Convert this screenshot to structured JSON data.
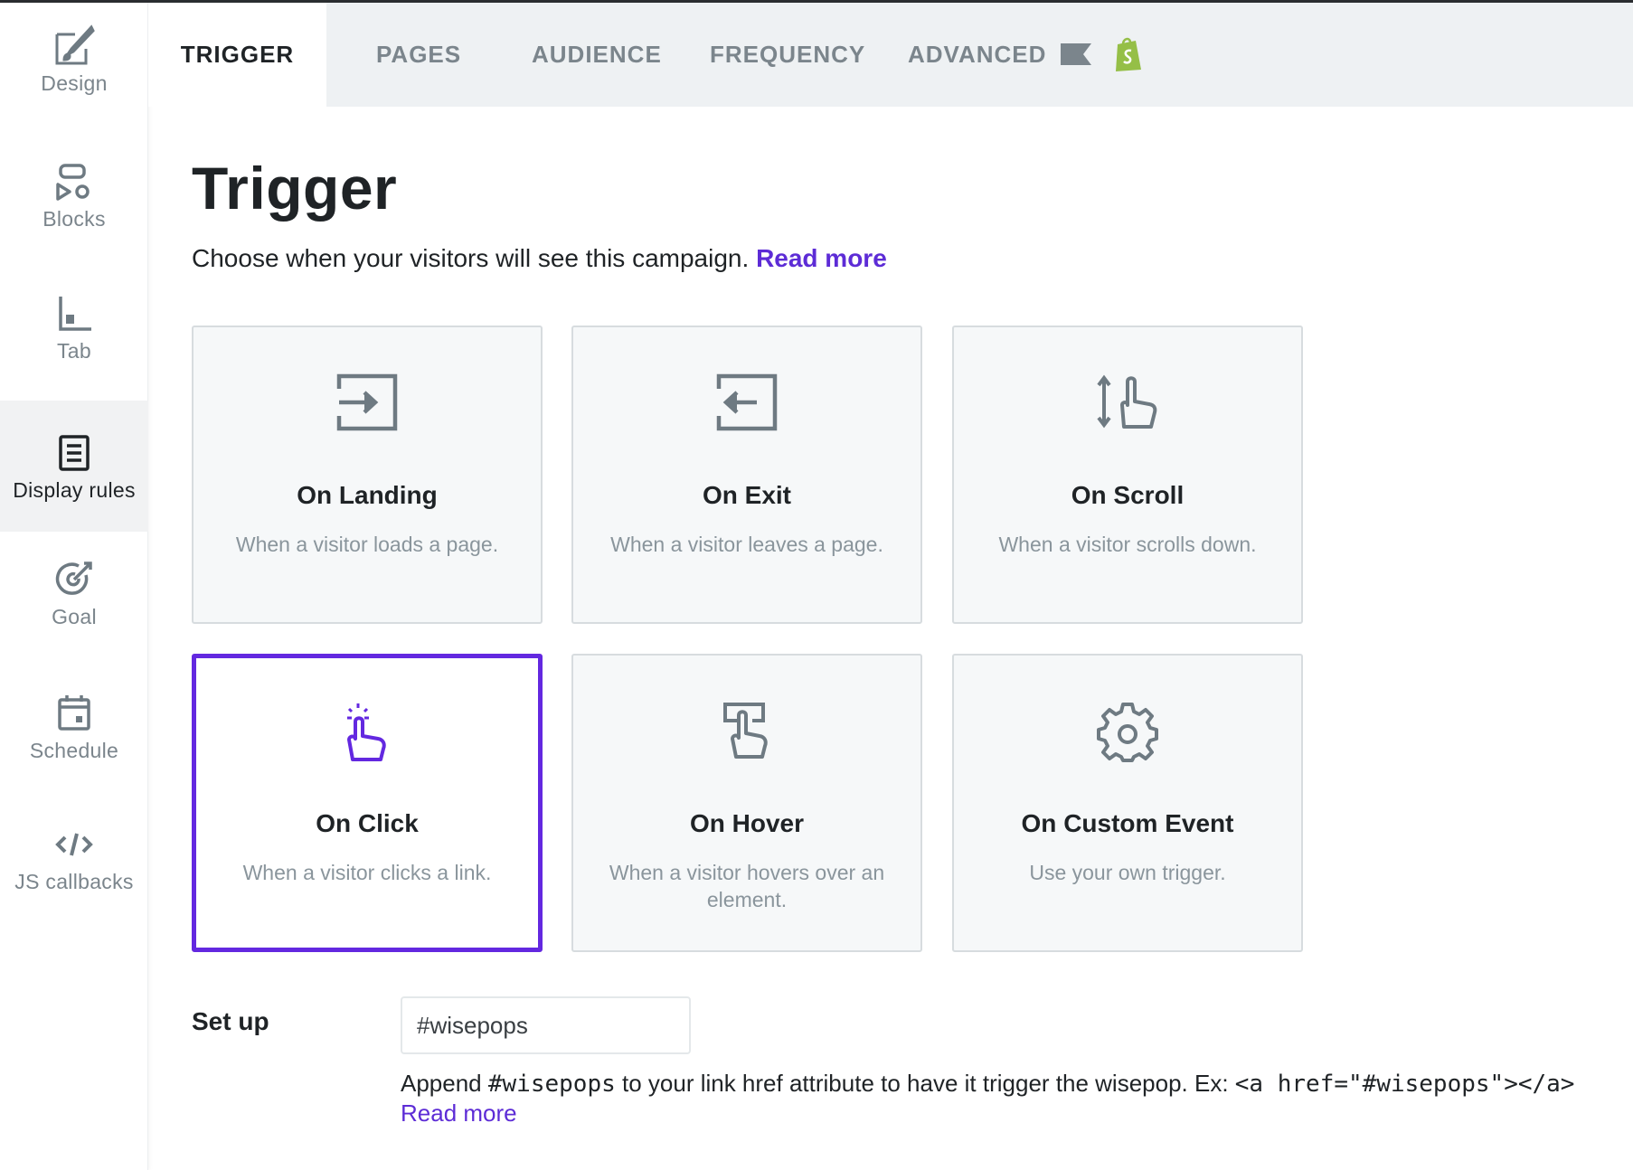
{
  "sidebar": {
    "items": [
      {
        "label": "Design",
        "icon": "brush-icon",
        "active": false
      },
      {
        "label": "Blocks",
        "icon": "blocks-icon",
        "active": false
      },
      {
        "label": "Tab",
        "icon": "tab-icon",
        "active": false
      },
      {
        "label": "Display rules",
        "icon": "list-icon",
        "active": true
      },
      {
        "label": "Goal",
        "icon": "target-icon",
        "active": false
      },
      {
        "label": "Schedule",
        "icon": "calendar-icon",
        "active": false
      },
      {
        "label": "JS callbacks",
        "icon": "code-icon",
        "active": false
      }
    ]
  },
  "tabs": [
    {
      "label": "TRIGGER",
      "active": true
    },
    {
      "label": "PAGES",
      "active": false
    },
    {
      "label": "AUDIENCE",
      "active": false
    },
    {
      "label": "FREQUENCY",
      "active": false
    },
    {
      "label": "ADVANCED",
      "active": false
    }
  ],
  "header": {
    "title": "Trigger",
    "subtitle": "Choose when your visitors will see this campaign.",
    "read_more": "Read more"
  },
  "cards": [
    {
      "title": "On Landing",
      "desc": "When a visitor loads a page.",
      "icon": "enter-icon",
      "selected": false
    },
    {
      "title": "On Exit",
      "desc": "When a visitor leaves a page.",
      "icon": "exit-icon",
      "selected": false
    },
    {
      "title": "On Scroll",
      "desc": "When a visitor scrolls down.",
      "icon": "scroll-hand-icon",
      "selected": false
    },
    {
      "title": "On Click",
      "desc": "When a visitor clicks a link.",
      "icon": "click-hand-icon",
      "selected": true
    },
    {
      "title": "On Hover",
      "desc": "When a visitor hovers over an element.",
      "icon": "hover-hand-icon",
      "selected": false
    },
    {
      "title": "On Custom Event",
      "desc": "Use your own trigger.",
      "icon": "gear-icon",
      "selected": false
    }
  ],
  "setup": {
    "label": "Set up",
    "value": "#wisepops",
    "help_prefix": "Append ",
    "help_code": "#wisepops",
    "help_middle": " to your link href attribute to have it trigger the wisepop. Ex: ",
    "help_example": "<a href=\"#wisepops\"></a>",
    "read_more": "Read more"
  },
  "colors": {
    "accent": "#6328e0",
    "link": "#5d2cd6",
    "icon_gray": "#6e7a82",
    "shopify_green": "#95bf47"
  }
}
